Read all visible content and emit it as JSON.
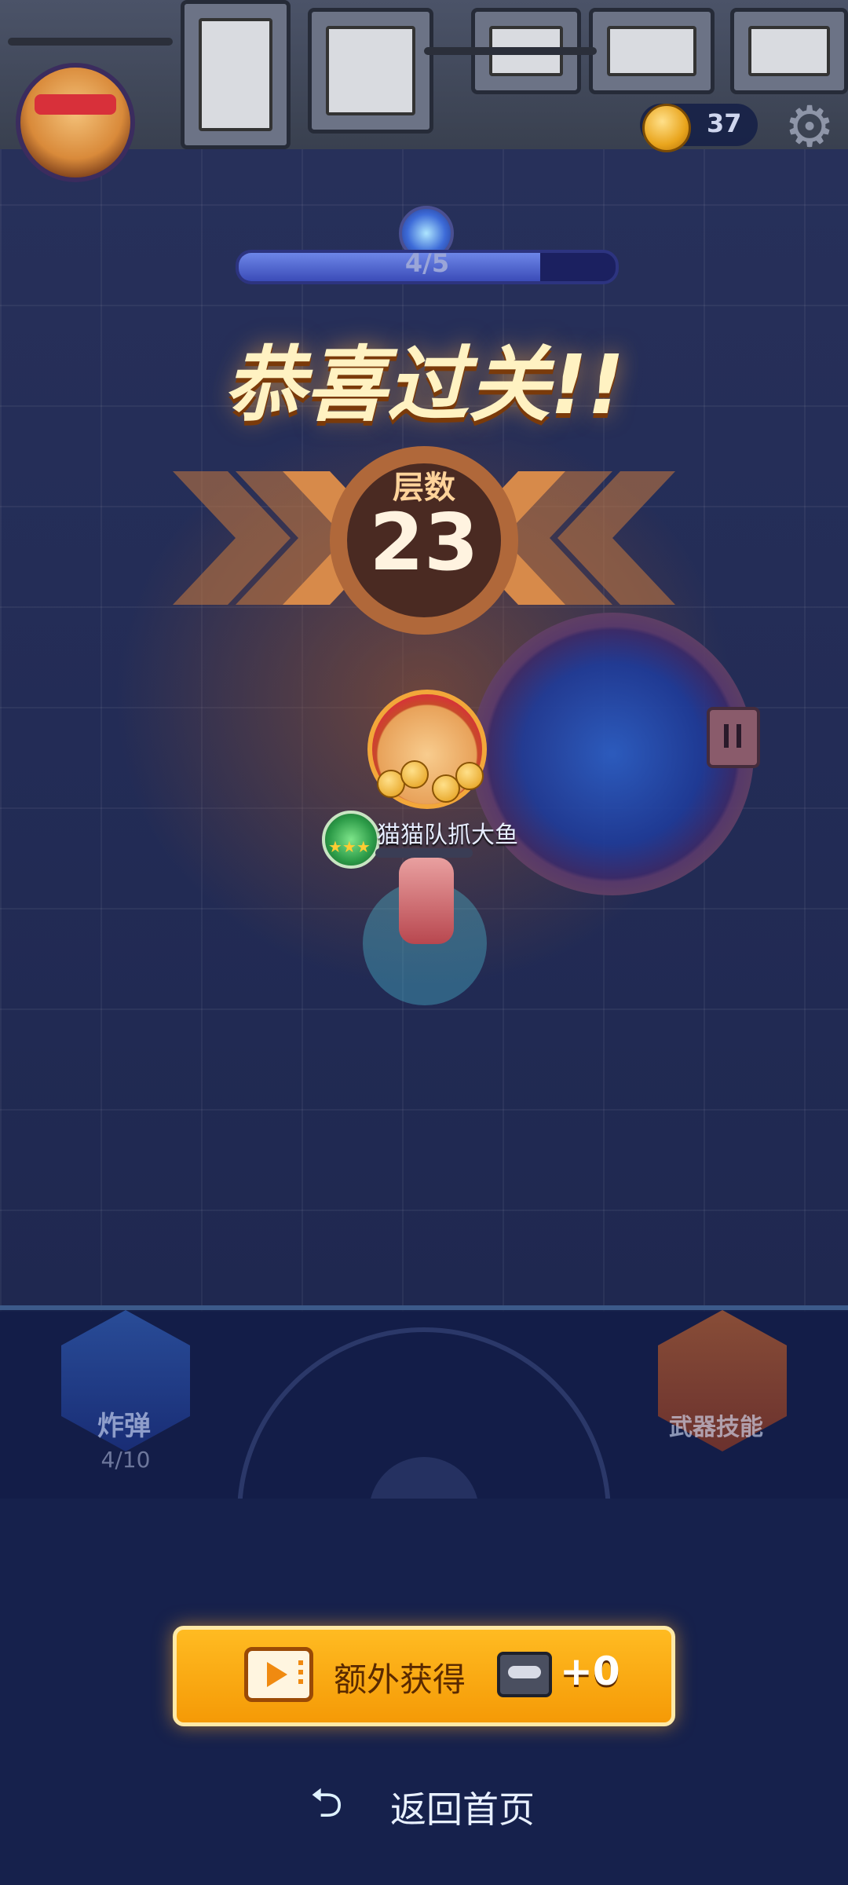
{
  "hud": {
    "coin_count": "37",
    "settings_icon": "gear-icon",
    "wave_progress": "4/5",
    "wave_fraction": 0.8
  },
  "result": {
    "title": "恭喜过关!!",
    "floor_label": "层数",
    "floor_value": "23"
  },
  "player": {
    "name": "猫猫队抓大鱼"
  },
  "controls": {
    "bomb_label": "炸弹",
    "bomb_count": "4/10",
    "weapon_skill_label": "武器技能"
  },
  "actions": {
    "extra_reward_label": "额外获得",
    "extra_reward_amount": "+0",
    "back_home_label": "返回首页"
  },
  "colors": {
    "accent_orange": "#f59a06",
    "background_navy": "#1a2350"
  }
}
